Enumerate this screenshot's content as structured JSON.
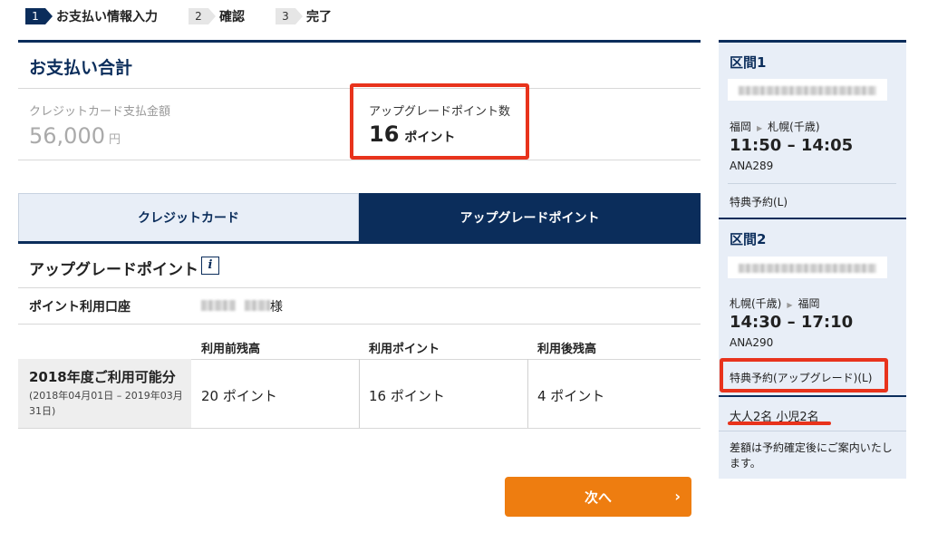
{
  "steps": [
    {
      "num": "1",
      "label": "お支払い情報入力"
    },
    {
      "num": "2",
      "label": "確認"
    },
    {
      "num": "3",
      "label": "完了"
    }
  ],
  "summary": {
    "title": "お支払い合計",
    "credit_label": "クレジットカード支払金額",
    "credit_amount": "56,000",
    "credit_unit": "円",
    "upgrade_label": "アップグレードポイント数",
    "upgrade_amount": "16",
    "upgrade_unit": "ポイント"
  },
  "tabs": {
    "credit": "クレジットカード",
    "upgrade": "アップグレードポイント"
  },
  "section": {
    "title": "アップグレードポイント",
    "info_icon": "i",
    "account_label": "ポイント利用口座",
    "account_suffix": "様"
  },
  "table": {
    "headers": [
      "利用前残高",
      "利用ポイント",
      "利用後残高"
    ],
    "row": {
      "title": "2018年度ご利用可能分",
      "period": "(2018年04月01日 – 2019年03月31日)",
      "before": "20 ポイント",
      "used": "16 ポイント",
      "after": "4 ポイント"
    }
  },
  "next_button": {
    "label": "次へ",
    "arrow": "›"
  },
  "sidebar": {
    "segments": [
      {
        "title": "区間1",
        "route_from": "福岡",
        "route_to": "札幌(千歳)",
        "time": "11:50 – 14:05",
        "flight": "ANA289",
        "fare": "特典予約(L)"
      },
      {
        "title": "区間2",
        "route_from": "札幌(千歳)",
        "route_to": "福岡",
        "time": "14:30 – 17:10",
        "flight": "ANA290",
        "fare": "特典予約(アップグレード)(L)"
      }
    ],
    "route_arrow": "▶",
    "passengers": "大人2名 小児2名",
    "note": "差額は予約確定後にご案内いたします。"
  },
  "colors": {
    "navy": "#0b2d5b",
    "highlight": "#e8331c",
    "button": "#ee7d10"
  }
}
